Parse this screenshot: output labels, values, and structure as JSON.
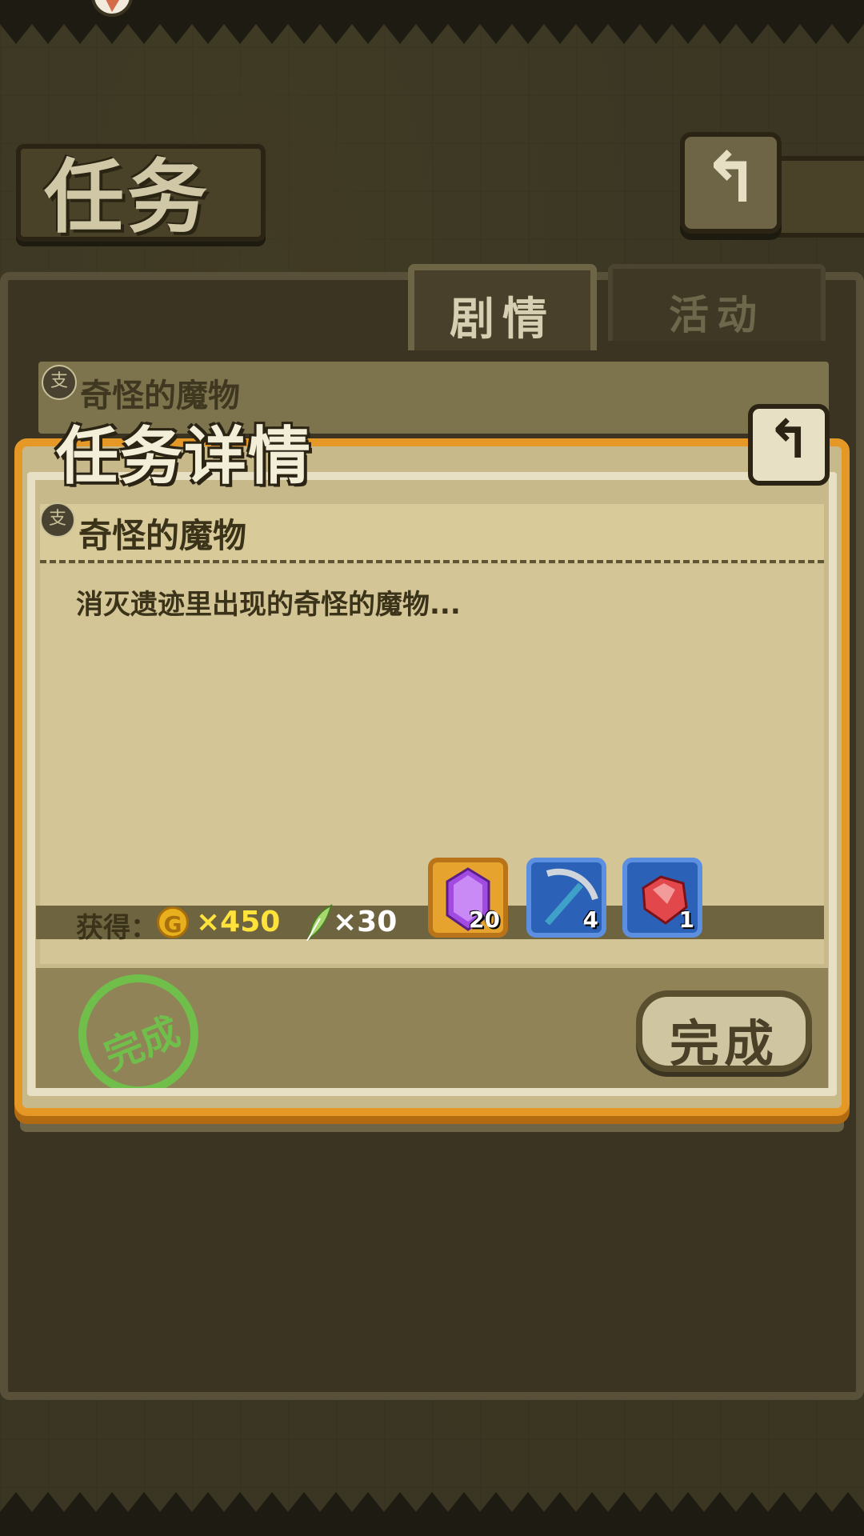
{
  "header": {
    "title": "任务",
    "back_glyph": "↰"
  },
  "tabs": [
    {
      "label": "剧情",
      "active": true
    },
    {
      "label": "活动",
      "active": false
    }
  ],
  "list": {
    "item_name": "奇怪的魔物",
    "chip_label": "支"
  },
  "dialog": {
    "title": "任务详情",
    "back_glyph": "↰",
    "chip_label": "支",
    "mission_name": "奇怪的魔物",
    "description": "消灭遗迹里出现的奇怪的魔物...",
    "reward_label": "获得：",
    "coin_symbol": "G",
    "gold": "×450",
    "feather": "×30",
    "items": [
      {
        "name": "purple-gem",
        "count": "20"
      },
      {
        "name": "pickaxe",
        "count": "4"
      },
      {
        "name": "red-crystal",
        "count": "1"
      }
    ],
    "complete_label": "完成",
    "stamp_label": "完成"
  },
  "colors": {
    "accent_orange": "#e59826",
    "gold_text": "#ffe33a",
    "stamp_green": "#6fbf4a"
  }
}
